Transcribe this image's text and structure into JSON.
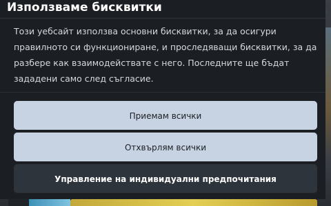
{
  "cookie_dialog": {
    "title": "Използваме бисквитки",
    "description": "Този уебсайт използва основни бисквитки, за да осигури правилното си функциониране, и проследяващи бисквитки, за да разбере как взаимодействате с него. Последните ще бъдат зададени само след съгласие.",
    "buttons": {
      "accept_all": "Приемам всички",
      "reject_all": "Отхвърлям всички",
      "manage_preferences": "Управление на индивидуални предпочитания"
    }
  },
  "colors": {
    "modal_background": "#1b1f24",
    "primary_button": "#c7d3e3",
    "secondary_button": "#2e343b",
    "title_text": "#ffffff",
    "body_text": "#d4d9de"
  }
}
